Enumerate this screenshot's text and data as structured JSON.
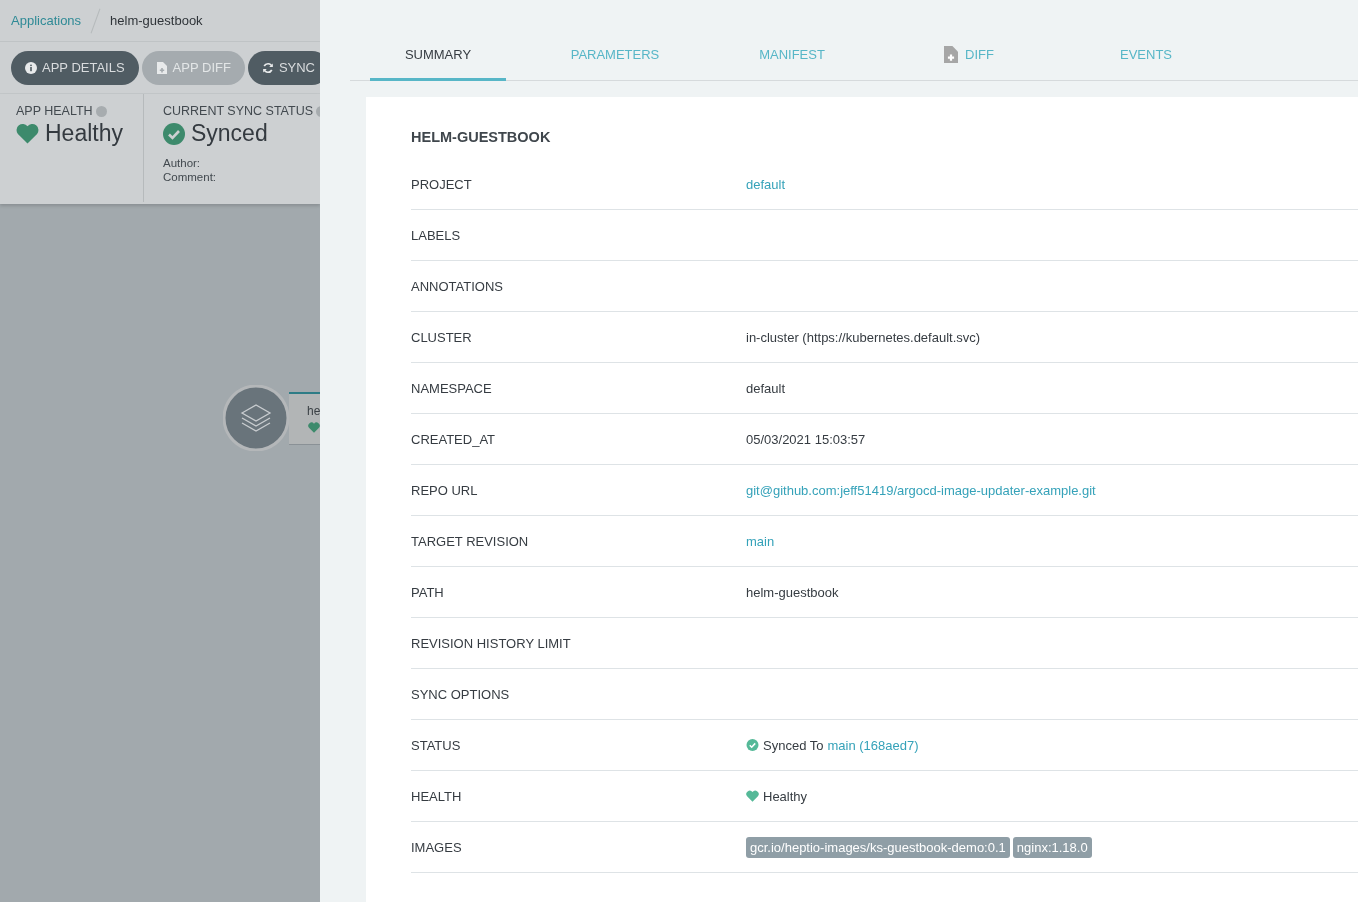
{
  "breadcrumb": {
    "parent": "Applications",
    "current": "helm-guestbook"
  },
  "actions": [
    {
      "label": "APP DETAILS",
      "kind": "info",
      "disabled": false
    },
    {
      "label": "APP DIFF",
      "kind": "file",
      "disabled": true
    },
    {
      "label": "SYNC",
      "kind": "sync",
      "disabled": false
    }
  ],
  "app_health": {
    "title": "APP HEALTH",
    "status": "Healthy"
  },
  "sync_status": {
    "title": "CURRENT SYNC STATUS",
    "status": "Synced",
    "author": "Author:",
    "comment": "Comment:"
  },
  "node": {
    "name": "he"
  },
  "tabs": [
    {
      "label": "SUMMARY",
      "selected": true
    },
    {
      "label": "PARAMETERS",
      "selected": false
    },
    {
      "label": "MANIFEST",
      "selected": false
    },
    {
      "label": "DIFF",
      "selected": false,
      "kind": "file"
    },
    {
      "label": "EVENTS",
      "selected": false
    }
  ],
  "summary": {
    "title": "HELM-GUESTBOOK",
    "rows": [
      {
        "label": "PROJECT",
        "kind": "link",
        "value": "default"
      },
      {
        "label": "LABELS",
        "kind": "empty"
      },
      {
        "label": "ANNOTATIONS",
        "kind": "empty"
      },
      {
        "label": "CLUSTER",
        "kind": "text",
        "value": "in-cluster (https://kubernetes.default.svc)"
      },
      {
        "label": "NAMESPACE",
        "kind": "text",
        "value": "default"
      },
      {
        "label": "CREATED_AT",
        "kind": "text",
        "value": "05/03/2021 15:03:57"
      },
      {
        "label": "REPO URL",
        "kind": "link",
        "value": "git@github.com:jeff51419/argocd-image-updater-example.git"
      },
      {
        "label": "TARGET REVISION",
        "kind": "link",
        "value": "main"
      },
      {
        "label": "PATH",
        "kind": "text",
        "value": "helm-guestbook"
      },
      {
        "label": "REVISION HISTORY LIMIT",
        "kind": "empty"
      },
      {
        "label": "SYNC OPTIONS",
        "kind": "empty"
      },
      {
        "label": "STATUS",
        "kind": "status",
        "value": "Synced To",
        "link": "main (168aed7)"
      },
      {
        "label": "HEALTH",
        "kind": "health",
        "value": "Healthy"
      },
      {
        "label": "IMAGES",
        "kind": "tags",
        "tags": [
          "gcr.io/heptio-images/ks-guestbook-demo:0.1",
          "nginx:1.18.0"
        ]
      }
    ]
  }
}
